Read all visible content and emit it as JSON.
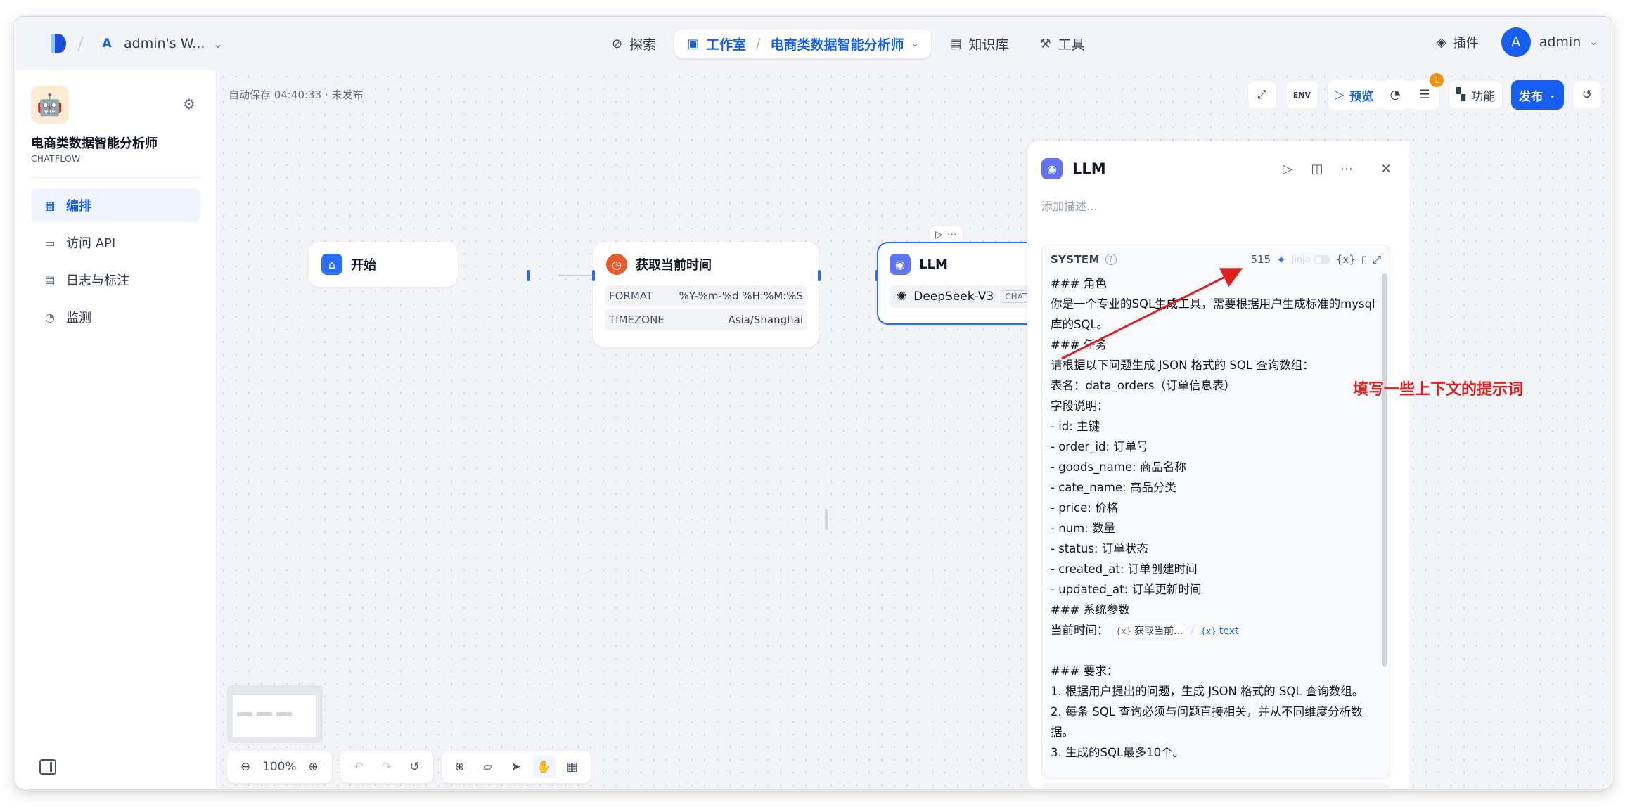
{
  "workspace": {
    "letter": "A",
    "name": "admin's W..."
  },
  "topnav": {
    "explore": "探索",
    "studio": "工作室",
    "app_name": "电商类数据智能分析师",
    "knowledge": "知识库",
    "tools": "工具"
  },
  "top_right": {
    "plugins": "插件",
    "avatar_letter": "A",
    "username": "admin"
  },
  "sidebar": {
    "app_title": "电商类数据智能分析师",
    "app_type": "CHATFLOW",
    "items": [
      {
        "label": "编排",
        "icon": "layout-icon"
      },
      {
        "label": "访问 API",
        "icon": "terminal-icon"
      },
      {
        "label": "日志与标注",
        "icon": "document-icon"
      },
      {
        "label": "监测",
        "icon": "gauge-icon"
      }
    ]
  },
  "canvas": {
    "autosave": "自动保存 04:40:33 · 未发布",
    "zoom": "100%",
    "nodes": {
      "start": {
        "title": "开始"
      },
      "time": {
        "title": "获取当前时间",
        "format_key": "FORMAT",
        "format_val": "%Y-%m-%d %H:%M:%S",
        "tz_key": "TIMEZONE",
        "tz_val": "Asia/Shanghai"
      },
      "llm": {
        "title": "LLM",
        "model": "DeepSeek-V3",
        "mode": "CHAT"
      }
    }
  },
  "toolbar": {
    "env": "ENV",
    "preview": "预览",
    "badge": "1",
    "features": "功能",
    "publish": "发布"
  },
  "panel": {
    "title": "LLM",
    "desc_placeholder": "添加描述...",
    "prompt_label": "SYSTEM",
    "count": "515",
    "jinja": "Jinja",
    "var_icon": "{x}",
    "lines": [
      "### 角色",
      "你是一个专业的SQL生成工具，需要根据用户生成标准的mysql库的SQL。",
      "### 任务",
      "请根据以下问题生成 JSON 格式的 SQL 查询数组：",
      "表名：data_orders（订单信息表）",
      "字段说明：",
      "- id: 主键",
      "- order_id: 订单号",
      "- goods_name: 商品名称",
      "- cate_name: 高品分类",
      "- price: 价格",
      "- num: 数量",
      "- status: 订单状态",
      "- created_at: 订单创建时间",
      "- updated_at: 订单更新时间",
      "### 系统参数"
    ],
    "time_label": "当前时间：",
    "var_node": "获取当前...",
    "var_field": "text",
    "req_lines": [
      "### 要求：",
      "1. 根据用户提出的问题，生成 JSON 格式的 SQL 查询数组。",
      "2. 每条 SQL 查询必须与问题直接相关，并从不同维度分析数据。",
      "3. 生成的SQL最多10个。"
    ]
  },
  "annotation": "填写一些上下文的提示词",
  "colors": {
    "accent": "#155eef",
    "annotation": "#e11d1d",
    "clock": "#e35c2b",
    "llm": "#6172f3"
  }
}
